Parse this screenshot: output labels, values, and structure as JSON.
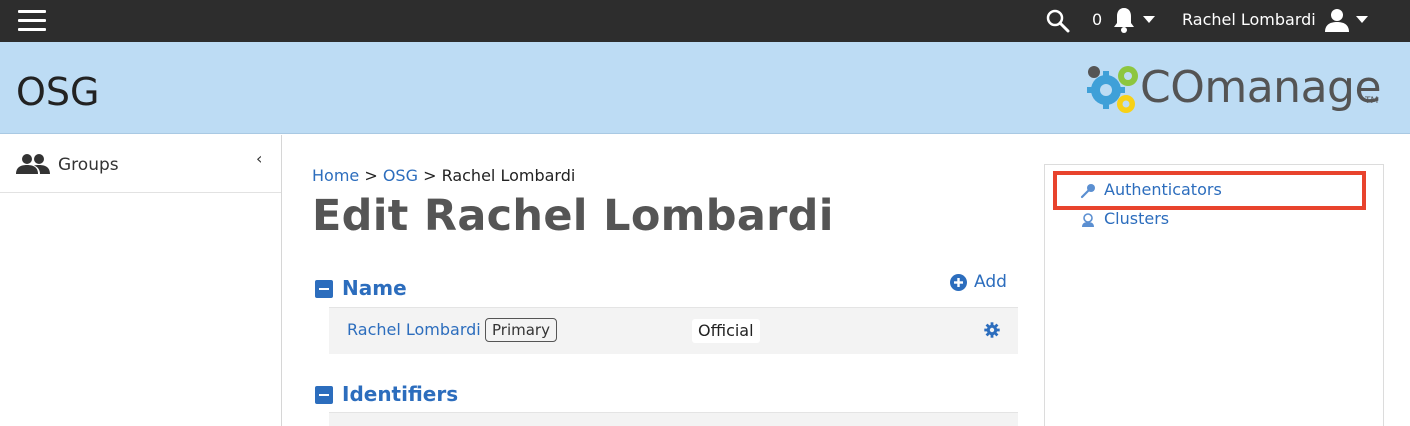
{
  "topbar": {
    "notification_count": "0",
    "user_name": "Rachel Lombardi"
  },
  "banner": {
    "co_name": "OSG",
    "logo_text": "COmanage",
    "logo_tm": "TM"
  },
  "sidebar": {
    "items": [
      {
        "label": "Groups",
        "icon": "groups-icon"
      }
    ],
    "collapse_glyph": "‹"
  },
  "breadcrumb": {
    "home": "Home",
    "sep1": " > ",
    "co": "OSG",
    "sep2": " > ",
    "current": "Rachel Lombardi"
  },
  "page": {
    "title": "Edit Rachel Lombardi"
  },
  "sections": {
    "name": {
      "title": "Name",
      "add_label": "Add",
      "rows": [
        {
          "name": "Rachel Lombardi",
          "badge": "Primary",
          "type": "Official"
        }
      ]
    },
    "identifiers": {
      "title": "Identifiers"
    }
  },
  "side_panel": {
    "links": [
      {
        "label": "Authenticators",
        "icon": "key-icon"
      },
      {
        "label": "Clusters",
        "icon": "cluster-icon"
      }
    ]
  },
  "colors": {
    "accent": "#2c6dbd",
    "banner": "#bddcf4",
    "topbar": "#2d2d2d",
    "highlight": "#e8432d"
  }
}
